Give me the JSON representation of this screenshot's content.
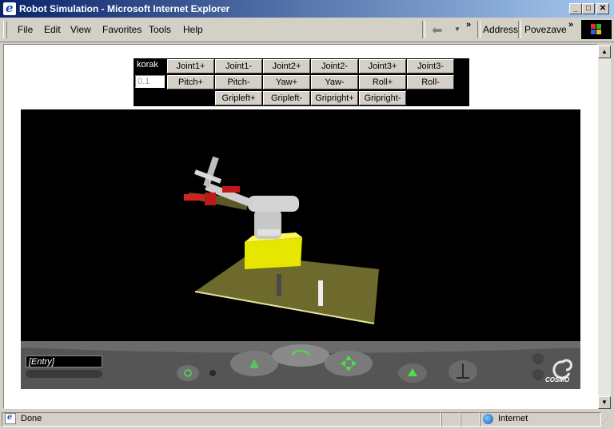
{
  "window": {
    "title": "Robot Simulation - Microsoft Internet Explorer"
  },
  "menu": {
    "items": [
      "File",
      "Edit",
      "View",
      "Favorites",
      "Tools",
      "Help"
    ]
  },
  "toolbar": {
    "address_label": "Address",
    "links_label": "Povezave"
  },
  "controls": {
    "step_label": "korak",
    "step_value": "0.1",
    "row1": [
      "Joint1+",
      "Joint1-",
      "Joint2+",
      "Joint2-",
      "Joint3+",
      "Joint3-"
    ],
    "row2": [
      "Pitch+",
      "Pitch-",
      "Yaw+",
      "Yaw-",
      "Roll+",
      "Roll-"
    ],
    "row3": [
      "Gripleft+",
      "Gripleft-",
      "Gripright+",
      "Gripright-"
    ]
  },
  "viewer": {
    "entry_text": "[Entry]",
    "brand": "COSMO"
  },
  "status": {
    "text": "Done",
    "zone": "Internet"
  },
  "colors": {
    "titlebar_start": "#0a246a",
    "titlebar_end": "#a6caf0",
    "floor": "#6e6a2e",
    "base": "#e6e600"
  }
}
